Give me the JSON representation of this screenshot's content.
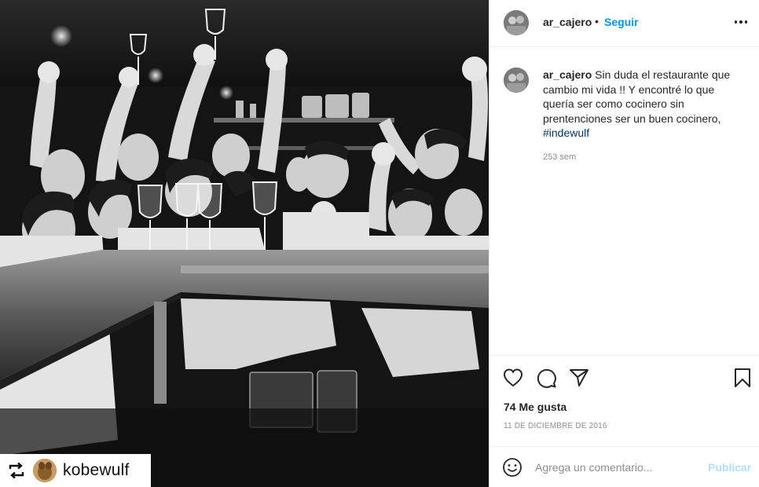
{
  "repost": {
    "name": "kobewulf",
    "icon": "repost-icon"
  },
  "post": {
    "header": {
      "username": "ar_cajero",
      "separator": "•",
      "follow_label": "Seguir",
      "more_icon": "more-options-icon"
    },
    "caption": {
      "username": "ar_cajero",
      "text": "Sin duda el restaurante que cambio mi vida !! Y encontré lo que quería ser como cocinero sin prentenciones ser un buen cocinero,",
      "hashtag": "#indewulf",
      "time_ago": "253 sem"
    },
    "actions": {
      "like_icon": "heart-icon",
      "comment_icon": "comment-icon",
      "share_icon": "send-icon",
      "save_icon": "bookmark-icon"
    },
    "likes": "74 Me gusta",
    "date": "11 DE DICIEMBRE DE 2016",
    "comment": {
      "placeholder": "Agrega un comentario...",
      "publish_label": "Publicar",
      "emoji_icon": "emoji-icon"
    }
  },
  "colors": {
    "accent": "#0095f6",
    "publish_disabled": "#b2dffc",
    "hashtag": "#00376b",
    "muted": "#8e8e8e"
  }
}
